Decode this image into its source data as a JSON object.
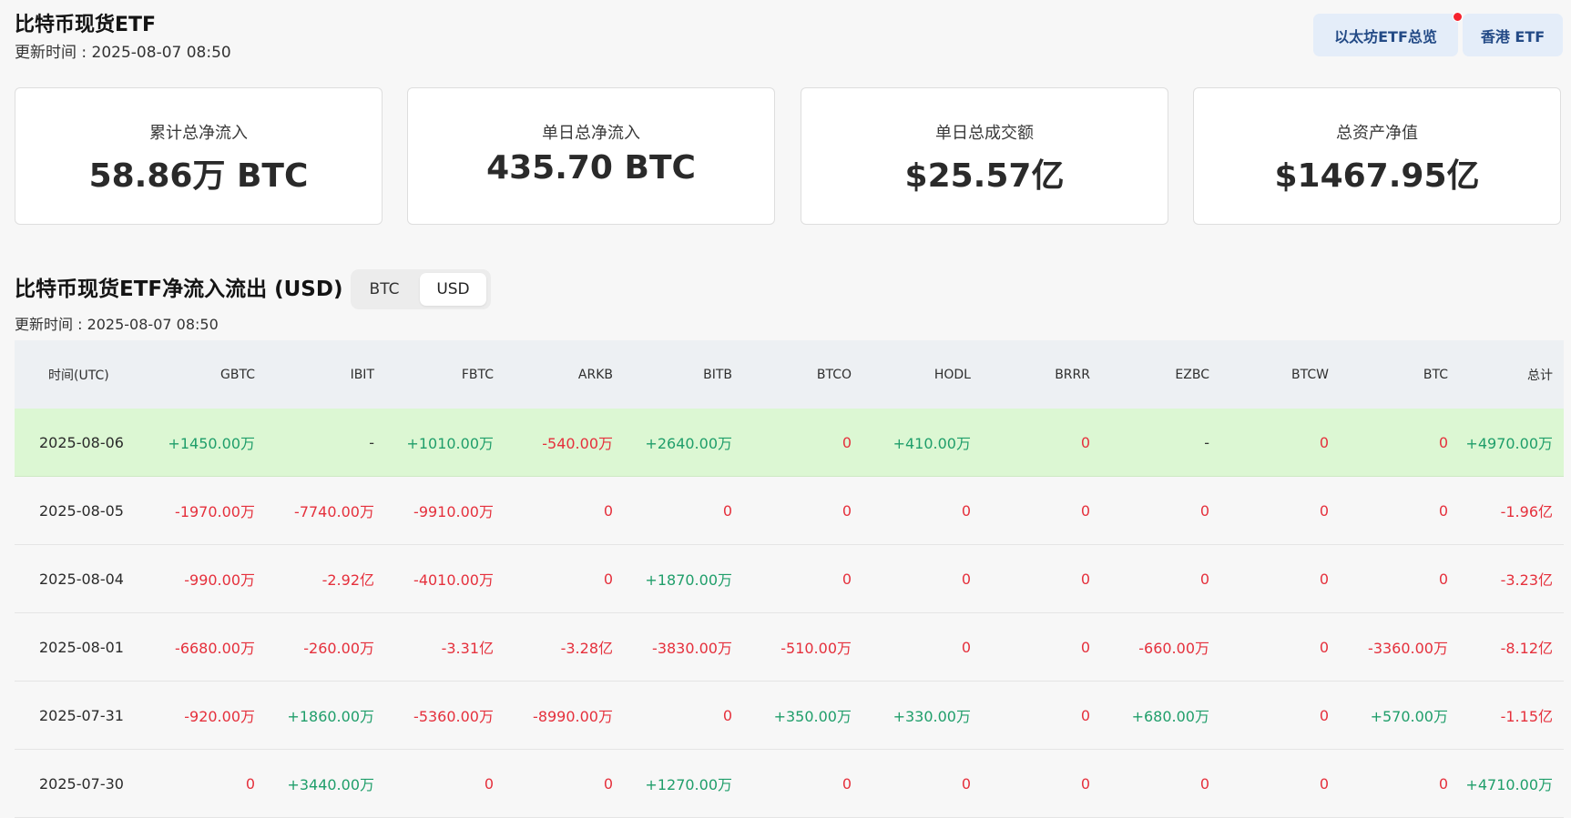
{
  "header": {
    "title": "比特币现货ETF",
    "update_time": "更新时间 : 2025-08-07 08:50",
    "eth_button": "以太坊ETF总览",
    "hk_button": "香港 ETF"
  },
  "stats": [
    {
      "label": "累计总净流入",
      "value": "58.86万 BTC"
    },
    {
      "label": "单日总净流入",
      "value": "435.70 BTC"
    },
    {
      "label": "单日总成交额",
      "value": "$25.57亿"
    },
    {
      "label": "总资产净值",
      "value": "$1467.95亿"
    }
  ],
  "section": {
    "title": "比特币现货ETF净流入流出 (USD)",
    "toggle_btc": "BTC",
    "toggle_usd": "USD",
    "selected": "USD",
    "update_time": "更新时间 : 2025-08-07 08:50"
  },
  "colors": {
    "positive": "#1f9e6a",
    "negative": "#e5303c",
    "highlight_row": "#dcf7d3"
  },
  "table": {
    "columns": [
      "时间(UTC)",
      "GBTC",
      "IBIT",
      "FBTC",
      "ARKB",
      "BITB",
      "BTCO",
      "HODL",
      "BRRR",
      "EZBC",
      "BTCW",
      "BTC",
      "总计"
    ],
    "rows": [
      [
        "2025-08-06",
        "+1450.00万",
        "-",
        "+1010.00万",
        "-540.00万",
        "+2640.00万",
        "0",
        "+410.00万",
        "0",
        "-",
        "0",
        "0",
        "+4970.00万"
      ],
      [
        "2025-08-05",
        "-1970.00万",
        "-7740.00万",
        "-9910.00万",
        "0",
        "0",
        "0",
        "0",
        "0",
        "0",
        "0",
        "0",
        "-1.96亿"
      ],
      [
        "2025-08-04",
        "-990.00万",
        "-2.92亿",
        "-4010.00万",
        "0",
        "+1870.00万",
        "0",
        "0",
        "0",
        "0",
        "0",
        "0",
        "-3.23亿"
      ],
      [
        "2025-08-01",
        "-6680.00万",
        "-260.00万",
        "-3.31亿",
        "-3.28亿",
        "-3830.00万",
        "-510.00万",
        "0",
        "0",
        "-660.00万",
        "0",
        "-3360.00万",
        "-8.12亿"
      ],
      [
        "2025-07-31",
        "-920.00万",
        "+1860.00万",
        "-5360.00万",
        "-8990.00万",
        "0",
        "+350.00万",
        "+330.00万",
        "0",
        "+680.00万",
        "0",
        "+570.00万",
        "-1.15亿"
      ],
      [
        "2025-07-30",
        "0",
        "+3440.00万",
        "0",
        "0",
        "+1270.00万",
        "0",
        "0",
        "0",
        "0",
        "0",
        "0",
        "+4710.00万"
      ]
    ]
  }
}
